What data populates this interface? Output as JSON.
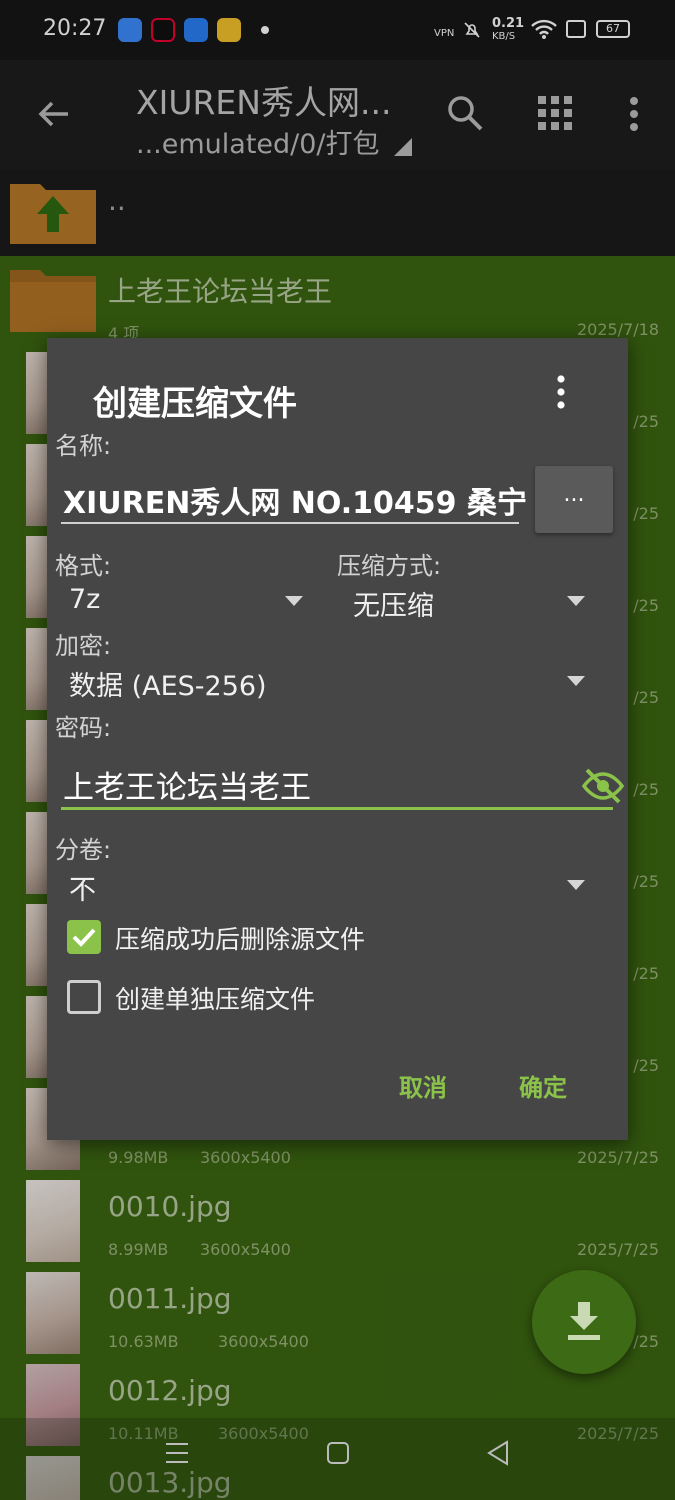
{
  "status_bar": {
    "time": "20:27",
    "net_speed_value": "0.21",
    "net_speed_unit": "KB/S",
    "vpn": "VPN",
    "battery": "67"
  },
  "toolbar": {
    "title": "XIUREN秀人网...",
    "path": "...emulated/0/打包"
  },
  "file_list": {
    "parent_label": "..",
    "folder": {
      "name": "上老王论坛当老王",
      "meta": "4 项",
      "date": "2025/7/18"
    },
    "partial_dates": [
      "/25",
      "/25",
      "/25",
      "/25",
      "/25",
      "/25",
      "/25",
      "/25"
    ],
    "items": [
      {
        "name": "",
        "size": "9.98MB",
        "dims": "3600x5400",
        "date": "2025/7/25"
      },
      {
        "name": "0010.jpg",
        "size": "8.99MB",
        "dims": "3600x5400",
        "date": "2025/7/25"
      },
      {
        "name": "0011.jpg",
        "size": "10.63MB",
        "dims": "3600x5400",
        "date": "/25"
      },
      {
        "name": "0012.jpg",
        "size": "10.11MB",
        "dims": "3600x5400",
        "date": "2025/7/25"
      },
      {
        "name": "0013.jpg",
        "size": "",
        "dims": "",
        "date": ""
      }
    ]
  },
  "dialog": {
    "title": "创建压缩文件",
    "name_label": "名称:",
    "name_value": "XIUREN秀人网 NO.10459 桑宁",
    "browse_label": "...",
    "format_label": "格式:",
    "format_value": "7z",
    "method_label": "压缩方式:",
    "method_value": "无压缩",
    "encrypt_label": "加密:",
    "encrypt_value": "数据 (AES-256)",
    "password_label": "密码:",
    "password_value": "上老王论坛当老王",
    "split_label": "分卷:",
    "split_value": "不",
    "delete_source_label": "压缩成功后删除源文件",
    "delete_source_checked": true,
    "separate_archive_label": "创建单独压缩文件",
    "separate_archive_checked": false,
    "cancel_label": "取消",
    "ok_label": "确定",
    "accent_color": "#8bc34a"
  },
  "colors": {
    "list_selected_bg": "#3b6612",
    "dialog_bg": "#464646",
    "toolbar_bg": "#1e1e1e"
  },
  "icons": [
    "back-arrow-icon",
    "search-icon",
    "grid-view-icon",
    "more-vert-icon",
    "folder-up-icon",
    "folder-icon",
    "eye-off-icon",
    "download-icon",
    "menu-icon",
    "home-icon",
    "back-triangle-icon"
  ]
}
